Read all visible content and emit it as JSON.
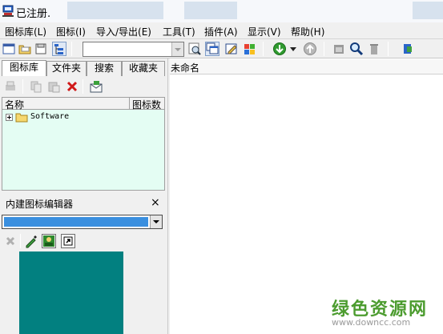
{
  "titlebar": {
    "title": "已注册."
  },
  "menu": [
    {
      "label": "图标库(L)"
    },
    {
      "label": "图标(I)"
    },
    {
      "label": "导入/导出(E)"
    },
    {
      "label": "工具(T)"
    },
    {
      "label": "插件(A)"
    },
    {
      "label": "显示(V)"
    },
    {
      "label": "帮助(H)"
    }
  ],
  "toolbar": {
    "filter_value": ""
  },
  "left_tabs": [
    {
      "label": "图标库"
    },
    {
      "label": "文件夹"
    },
    {
      "label": "搜索"
    },
    {
      "label": "收藏夹"
    }
  ],
  "tree": {
    "col_name": "名称",
    "col_count": "图标数",
    "items": [
      {
        "label": "Software"
      }
    ]
  },
  "editor": {
    "title": "内建图标编辑器",
    "close": "×",
    "selected_color": "#3a8fdf",
    "canvas_color": "#028080"
  },
  "list": {
    "col_header": "未命名"
  },
  "watermark": {
    "text": "绿色资源网",
    "url": "www.downcc.com"
  }
}
